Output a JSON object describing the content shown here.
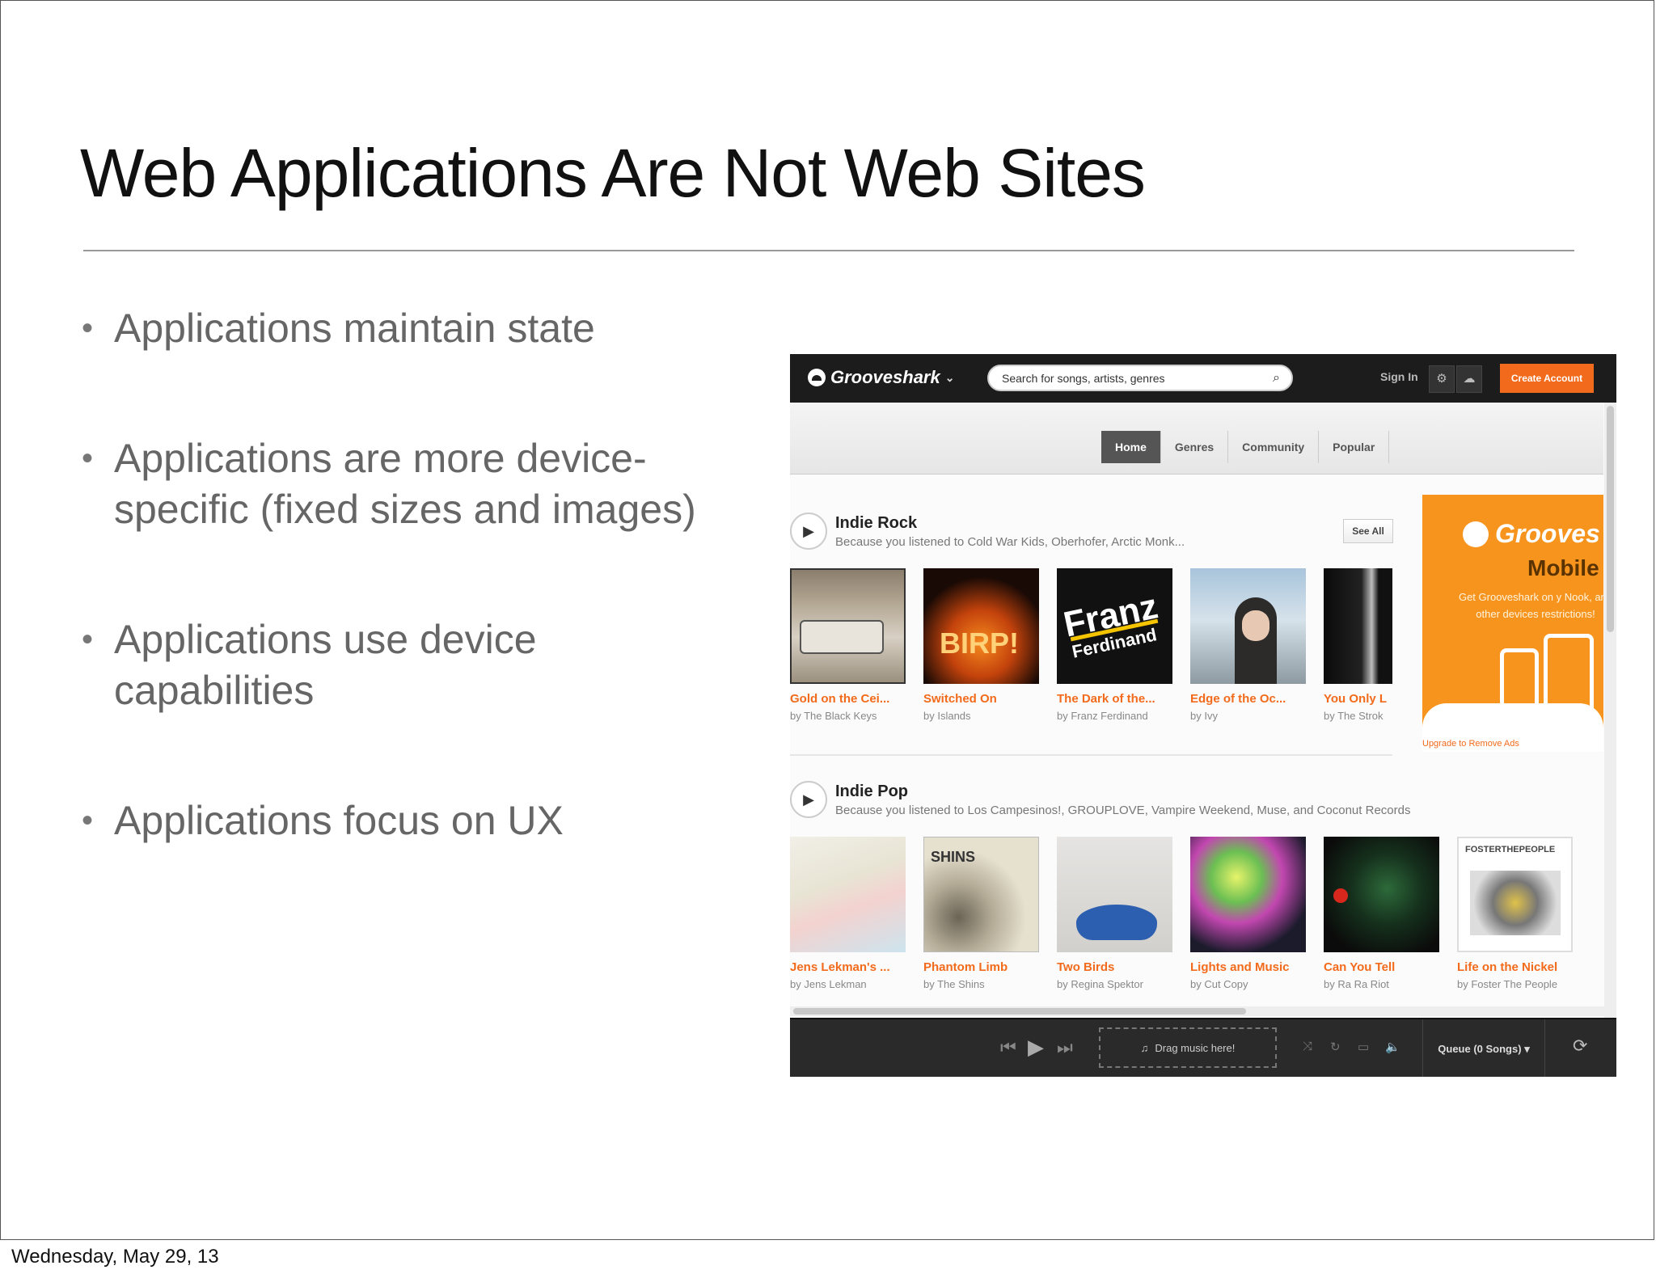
{
  "slide": {
    "title": "Web Applications Are Not Web Sites",
    "bullets": [
      "Applications maintain state",
      "Applications are more device-specific (fixed sizes and images)",
      "Applications use device capabilities",
      "Applications focus on UX"
    ],
    "footer_date": "Wednesday, May 29, 13"
  },
  "grooveshark": {
    "brand": "Grooveshark",
    "search_placeholder": "Search for songs, artists, genres",
    "sign_in": "Sign In",
    "create_account": "Create Account",
    "tabs": [
      "Home",
      "Genres",
      "Community",
      "Popular"
    ],
    "active_tab": "Home",
    "sections": [
      {
        "title": "Indie Rock",
        "subtitle": "Because you listened to Cold War Kids, Oberhofer, Arctic Monk...",
        "see_all": "See All",
        "albums": [
          {
            "title": "Gold on the Cei...",
            "artist": "by The Black Keys"
          },
          {
            "title": "Switched On",
            "artist": "by Islands"
          },
          {
            "title": "The Dark of the...",
            "artist": "by Franz Ferdinand"
          },
          {
            "title": "Edge of the Oc...",
            "artist": "by Ivy"
          },
          {
            "title": "You Only L",
            "artist": "by The Strok"
          }
        ]
      },
      {
        "title": "Indie Pop",
        "subtitle": "Because you listened to Los Campesinos!, GROUPLOVE, Vampire Weekend, Muse, and Coconut Records",
        "albums": [
          {
            "title": "Jens Lekman's ...",
            "artist": "by Jens Lekman"
          },
          {
            "title": "Phantom Limb",
            "artist": "by The Shins"
          },
          {
            "title": "Two Birds",
            "artist": "by Regina Spektor"
          },
          {
            "title": "Lights and Music",
            "artist": "by Cut Copy"
          },
          {
            "title": "Can You Tell",
            "artist": "by Ra Ra Riot"
          },
          {
            "title": "Life on the Nickel",
            "artist": "by Foster The People"
          }
        ]
      }
    ],
    "cover_text": {
      "franz": "Franz",
      "ferdinand": "Ferdinand",
      "birp": "BIRP!",
      "shins": "SHINS",
      "foster": "FOSTERTHEPEOPLE"
    },
    "ad": {
      "brand": "Grooves",
      "product": "Mobile",
      "text": "Get Grooveshark on y Nook, and other devices restrictions!",
      "link": "Upgrade to Remove Ads"
    },
    "player": {
      "drop_text": "Drag music here!",
      "queue": "Queue (0 Songs)"
    }
  }
}
